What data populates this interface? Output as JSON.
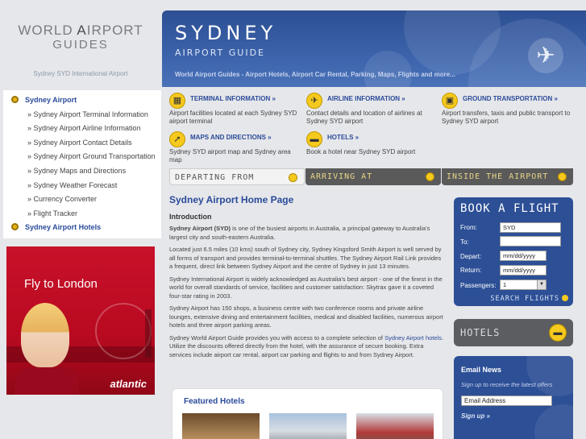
{
  "brand": {
    "logo_line1_a": "WORLD",
    "logo_line1_b": "A",
    "logo_line1_c": "IRPORT",
    "logo_line2": "GUIDES",
    "tagline": "Sydney SYD International Airport"
  },
  "left_nav": [
    {
      "label": "Sydney Airport",
      "main": true
    },
    {
      "label": "» Sydney Airport Terminal Information"
    },
    {
      "label": "» Sydney Airport Airline Information"
    },
    {
      "label": "» Sydney Airport Contact Details"
    },
    {
      "label": "» Sydney Airport Ground Transportation"
    },
    {
      "label": "» Sydney Maps and Directions"
    },
    {
      "label": "» Sydney Weather Forecast"
    },
    {
      "label": "» Currency Converter"
    },
    {
      "label": "» Flight Tracker"
    },
    {
      "label": "Sydney Airport Hotels",
      "main": true
    }
  ],
  "ad": {
    "headline": "Fly to London",
    "brand": "atlantic",
    "colors": {
      "bg": "#c8112a"
    }
  },
  "header": {
    "title": "SYDNEY",
    "subtitle": "AIRPORT GUIDE",
    "links_line": "World Airport Guides - Airport Hotels, Airport Car Rental, Parking, Maps, Flights and more...",
    "plane_icon": "airplane-icon"
  },
  "quick_links": {
    "terminal": {
      "title": "TERMINAL INFORMATION »",
      "desc": "Airport facilities located at each Sydney SYD airport terminal",
      "icon": "terminal-icon"
    },
    "airline": {
      "title": "AIRLINE INFORMATION »",
      "desc": "Contact details and location of airlines at Sydney SYD airport",
      "icon": "plane-icon"
    },
    "ground": {
      "title": "GROUND TRANSPORTATION »",
      "desc": "Airport transfers, taxis and public transport to Sydney SYD airport",
      "icon": "bus-icon"
    },
    "maps": {
      "title": "MAPS AND DIRECTIONS »",
      "desc": "Sydney SYD airport map and Sydney area map",
      "icon": "compass-icon"
    },
    "hotels": {
      "title": "HOTELS »",
      "desc": "Book a hotel near Sydney SYD airport",
      "icon": "bed-icon"
    }
  },
  "bars": {
    "departing": "DEPARTING FROM",
    "arriving": "ARRIVING AT",
    "inside": "INSIDE THE AIRPORT"
  },
  "content": {
    "title": "Sydney Airport Home Page",
    "intro_heading": "Introduction",
    "p1_bold": "Sydney Airport (SYD)",
    "p1_rest": " is one of the busiest airports in Australia, a principal gateway to Australia's largest city and south-eastern Australia.",
    "p2": "Located just 6.5 miles (10 kms) south of Sydney city, Sydney Kingsford Smith Airport is well served by all forms of transport and provides terminal-to-terminal shuttles. The Sydney Airport Rail Link provides a frequent, direct link between Sydney Airport and the centre of Sydney in just 13 minutes.",
    "p3": "Sydney International Airport is widely acknowledged as Australia's best airport - one of the finest in the world for overall standards of service, facilities and customer satisfaction: Skytrax gave it a coveted four-star rating in 2003.",
    "p4": "Sydney Airport has 150 shops, a business centre with two conference rooms and private airline lounges, extensive dining and entertainment facilities, medical and disabled facilities, numerous airport hotels and three airport parking areas.",
    "p5_a": "Sydney World Airport Guide provides you with access to a complete selection of ",
    "p5_link": "Sydney Airport hotels",
    "p5_b": ". Utilize the discounts offered directly from the hotel, with the assurance of secure booking. Extra services include airport car rental, airport car parking and flights to and from Sydney Airport."
  },
  "featured": {
    "title": "Featured Hotels"
  },
  "book_flight": {
    "title": "BOOK A FLIGHT",
    "from_label": "From:",
    "from_value": "SYD",
    "to_label": "To:",
    "to_value": "",
    "depart_label": "Depart:",
    "depart_value": "mm/dd/yyyy",
    "return_label": "Return:",
    "return_value": "mm/dd/yyyy",
    "passengers_label": "Passengers:",
    "passengers_value": "1",
    "search_label": "SEARCH FLIGHTS"
  },
  "hotels_box": {
    "title": "HOTELS"
  },
  "email_news": {
    "title": "Email News",
    "subtitle": "Sign up to receive the latest offers",
    "placeholder": "Email Address",
    "signup": "Sign up »"
  },
  "colors": {
    "accent_blue": "#2c4f96",
    "link": "#2a4a9a",
    "yellow": "#f5c91d"
  }
}
